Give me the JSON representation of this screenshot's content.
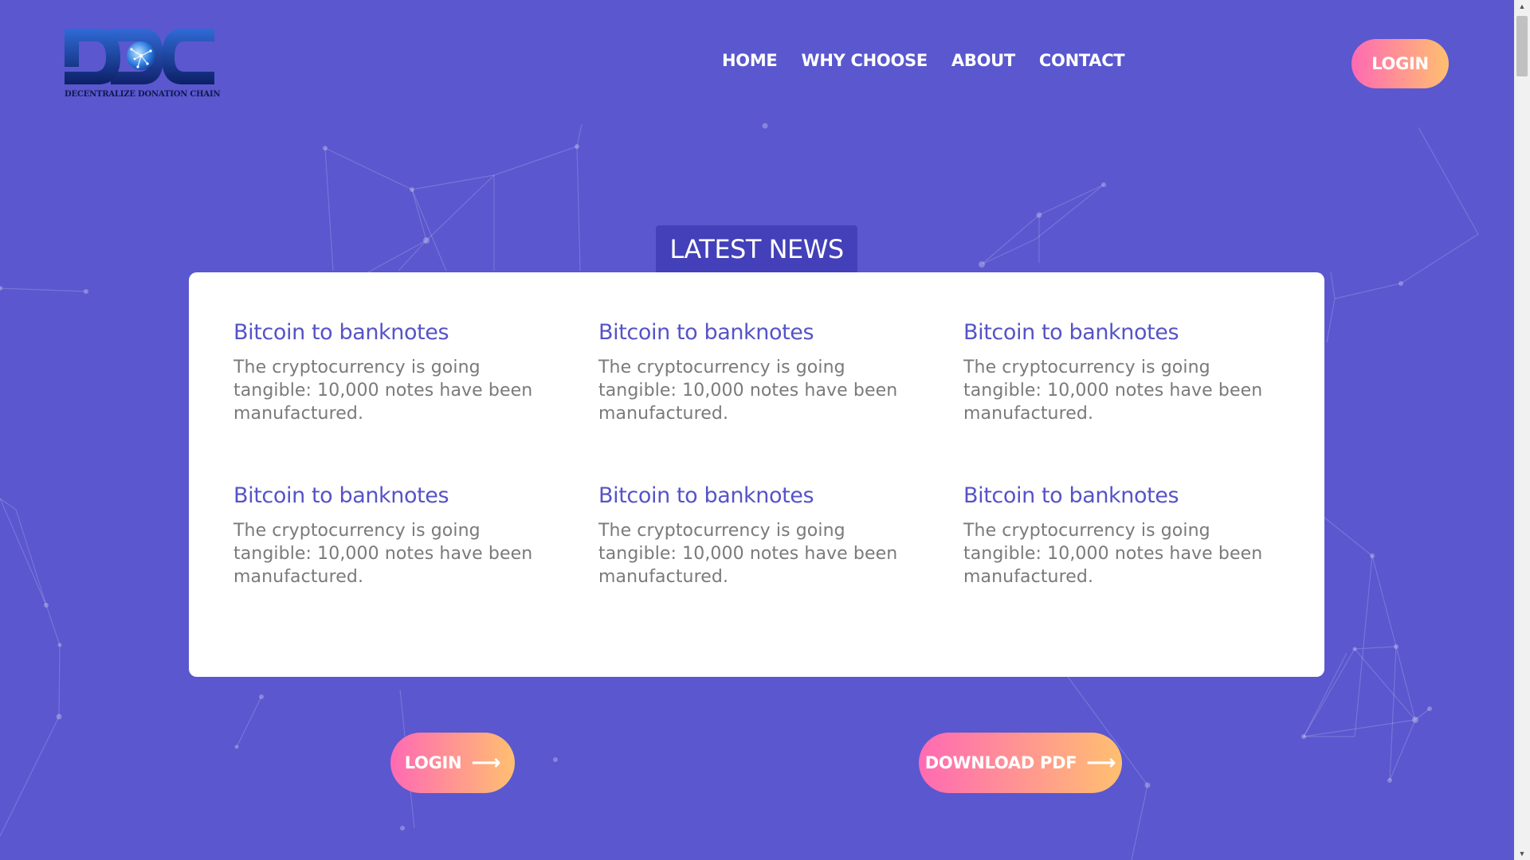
{
  "brand": {
    "caption": "DECENTRALIZE DONATION CHAIN"
  },
  "nav": {
    "items": [
      {
        "label": "HOME"
      },
      {
        "label": "WHY CHOOSE"
      },
      {
        "label": "ABOUT"
      },
      {
        "label": "CONTACT"
      }
    ],
    "login_label": "LOGIN"
  },
  "news": {
    "heading": "LATEST NEWS",
    "items": [
      {
        "title": "Bitcoin to banknotes",
        "text": "The cryptocurrency is going tangible: 10,000 notes have been manufactured."
      },
      {
        "title": "Bitcoin to banknotes",
        "text": "The cryptocurrency is going tangible: 10,000 notes have been manufactured."
      },
      {
        "title": "Bitcoin to banknotes",
        "text": "The cryptocurrency is going tangible: 10,000 notes have been manufactured."
      },
      {
        "title": "Bitcoin to banknotes",
        "text": "The cryptocurrency is going tangible: 10,000 notes have been manufactured."
      },
      {
        "title": "Bitcoin to banknotes",
        "text": "The cryptocurrency is going tangible: 10,000 notes have been manufactured."
      },
      {
        "title": "Bitcoin to banknotes",
        "text": "The cryptocurrency is going tangible: 10,000 notes have been manufactured."
      }
    ]
  },
  "actions": {
    "login_label": "LOGIN",
    "download_label": "DOWNLOAD PDF",
    "arrow_icon": "arrow-right-icon"
  },
  "colors": {
    "background": "#5a57cf",
    "accent": "#5653c7",
    "heading_tab": "#4340b9",
    "gradient_start": "#ff6ab3",
    "gradient_end": "#ffbf70"
  }
}
